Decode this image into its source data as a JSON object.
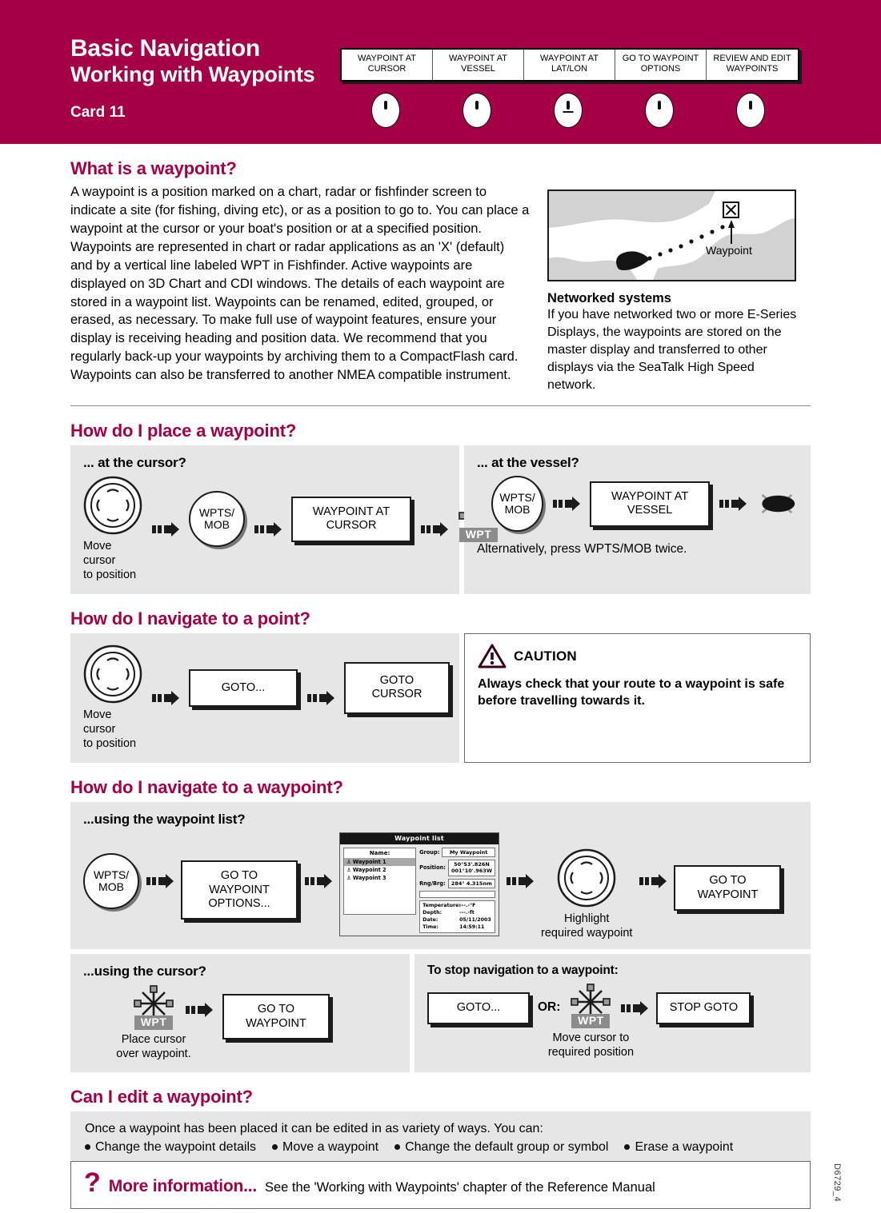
{
  "header": {
    "title_main": "Basic Navigation",
    "title_sub": "Working with Waypoints",
    "card": "Card 11",
    "tabs": [
      {
        "line1": "WAYPOINT AT",
        "line2": "CURSOR"
      },
      {
        "line1": "WAYPOINT AT",
        "line2": "VESSEL"
      },
      {
        "line1": "WAYPOINT AT",
        "line2": "LAT/LON"
      },
      {
        "line1": "GO TO WAYPOINT",
        "line2": "OPTIONS"
      },
      {
        "line1": "REVIEW AND EDIT",
        "line2": "WAYPOINTS"
      }
    ]
  },
  "what_is": {
    "heading": "What is a waypoint?",
    "body": "A waypoint is a position marked on a chart, radar or fishfinder screen to indicate a site (for fishing, diving etc), or as a position to go to. You can place a waypoint at the cursor or your boat's position or at a specified position. Waypoints are represented in chart or radar applications as an 'X' (default) and by a vertical line labeled WPT in Fishfinder.  Active waypoints are displayed on 3D Chart and CDI windows.  The details of each waypoint are stored in a waypoint list.  Waypoints can be renamed, edited, grouped, or erased, as necessary.  To make full use of waypoint features, ensure your display is receiving heading and position data.  We recommend that you regularly back-up your waypoints by archiving them to a CompactFlash card.  Waypoints can also be transferred to another NMEA compatible instrument.",
    "chart_label": "Waypoint",
    "networked_heading": "Networked systems",
    "networked_body": "If you have networked two or more E-Series Displays, the waypoints are stored on the master display and transferred to other displays via the SeaTalk High Speed network."
  },
  "place": {
    "heading": "How do I place a waypoint?",
    "cursor": {
      "title": "... at the cursor?",
      "trackpad_caption": "Move cursor\nto position",
      "key_wpts": "WPTS/\nMOB",
      "softkey": "WAYPOINT AT\nCURSOR",
      "wpt_label": "WPT"
    },
    "vessel": {
      "title": "... at the vessel?",
      "key_wpts": "WPTS/\nMOB",
      "softkey": "WAYPOINT AT\nVESSEL",
      "note": "Alternatively, press WPTS/MOB twice."
    }
  },
  "nav_point": {
    "heading": "How do I navigate to a point?",
    "trackpad_caption": "Move cursor\nto position",
    "goto": "GOTO...",
    "goto_cursor": "GOTO CURSOR",
    "caution_word": "CAUTION",
    "caution_text": "Always check that your route to a waypoint is safe before travelling towards it."
  },
  "nav_waypoint": {
    "heading": "How do I navigate to a waypoint?",
    "list_title": "...using the waypoint list?",
    "key_wpts": "WPTS/\nMOB",
    "softkey_options": "GO TO WAYPOINT\nOPTIONS...",
    "highlight_caption": "Highlight\nrequired waypoint",
    "softkey_goto": "GO TO WAYPOINT",
    "cursor_title": "...using the cursor?",
    "cursor_caption": "Place cursor\nover waypoint.",
    "cursor_softkey": "GO TO WAYPOINT",
    "wpt_label": "WPT",
    "stop_title": "To stop navigation to a waypoint:",
    "stop_goto": "GOTO...",
    "stop_or": "OR:",
    "stop_caption": "Move cursor to\nrequired position",
    "stop_softkey": "STOP GOTO"
  },
  "waypoint_list": {
    "title": "Waypoint list",
    "name_header": "Name:",
    "items": [
      "Waypoint 1",
      "Waypoint 2",
      "Waypoint 3"
    ],
    "fields": [
      {
        "label": "Group:",
        "value": "My Waypoint"
      },
      {
        "label": "Position:",
        "value": "50°53'.826N\n001°10'.963W"
      },
      {
        "label": "Rng/Brg:",
        "value": "284°    4.315nm"
      }
    ],
    "info": [
      {
        "key": "Temperature:",
        "value": "---.-°F"
      },
      {
        "key": "Depth:",
        "value": "---.-ft"
      },
      {
        "key": "Date:",
        "value": "05/11/2003"
      },
      {
        "key": "Time:",
        "value": "14:59:11"
      }
    ]
  },
  "edit": {
    "heading": "Can I edit a waypoint?",
    "lead": "Once a waypoint has been placed it can be edited in as variety of ways. You can:",
    "items": [
      "Change the waypoint details",
      "Move a waypoint",
      "Change the default group or symbol",
      "Erase a waypoint"
    ]
  },
  "footer": {
    "more": "More information...",
    "text": "See the 'Working with Waypoints' chapter of the Reference Manual",
    "doc_code": "D6729_4"
  },
  "colors": {
    "brand": "#a50045",
    "panel": "#e6e6e6"
  }
}
